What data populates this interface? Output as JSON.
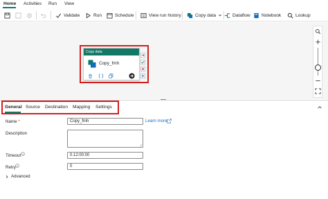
{
  "menu": {
    "tabs": [
      {
        "label": "Home",
        "active": true
      },
      {
        "label": "Activities"
      },
      {
        "label": "Run"
      },
      {
        "label": "View"
      }
    ]
  },
  "toolbar": {
    "validate": "Validate",
    "run": "Run",
    "schedule": "Schedule",
    "view_run_history": "View run history",
    "copy_data": "Copy data",
    "dataflow": "Dataflow",
    "notebook": "Notebook",
    "lookup": "Lookup"
  },
  "activity": {
    "type_label": "Copy data",
    "name": "Copy_fmh"
  },
  "panel": {
    "tabs": [
      {
        "label": "General",
        "active": true
      },
      {
        "label": "Source"
      },
      {
        "label": "Destination"
      },
      {
        "label": "Mapping"
      },
      {
        "label": "Settings"
      }
    ],
    "name_label": "Name",
    "name_required_mark": "*",
    "name_value": "Copy_fmh",
    "learn_more": "Learn more",
    "description_label": "Description",
    "description_value": "",
    "timeout_label": "Timeout",
    "timeout_value": "0.12:00:00",
    "retry_label": "Retry",
    "retry_value": "0",
    "advanced_label": "Advanced"
  },
  "colors": {
    "accent": "#117865",
    "highlight": "#d21d1d",
    "link": "#0f6cbd"
  }
}
